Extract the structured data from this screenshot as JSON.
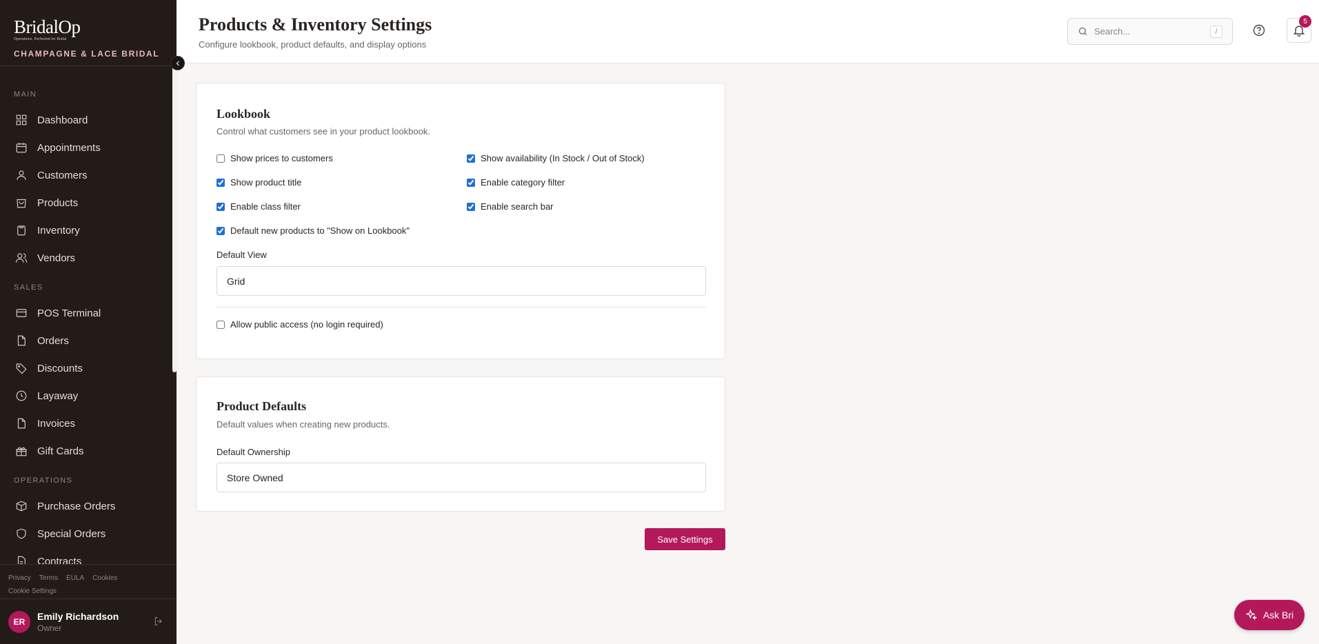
{
  "brand": {
    "logo": "BridalOp",
    "tagline": "Operations, Perfected for Bridal",
    "store_name": "CHAMPAGNE & LACE BRIDAL"
  },
  "sidebar": {
    "sections": {
      "main": "MAIN",
      "sales": "SALES",
      "operations": "OPERATIONS"
    },
    "items": {
      "dashboard": "Dashboard",
      "appointments": "Appointments",
      "customers": "Customers",
      "products": "Products",
      "inventory": "Inventory",
      "vendors": "Vendors",
      "pos": "POS Terminal",
      "orders": "Orders",
      "discounts": "Discounts",
      "layaway": "Layaway",
      "invoices": "Invoices",
      "gift_cards": "Gift Cards",
      "purchase_orders": "Purchase Orders",
      "special_orders": "Special Orders",
      "contracts": "Contracts"
    },
    "footer_links": {
      "privacy": "Privacy",
      "terms": "Terms",
      "eula": "EULA",
      "cookies": "Cookies",
      "cookie_settings": "Cookie Settings"
    },
    "user": {
      "initials": "ER",
      "name": "Emily Richardson",
      "role": "Owner"
    }
  },
  "header": {
    "title": "Products & Inventory Settings",
    "subtitle": "Configure lookbook, product defaults, and display options",
    "search_placeholder": "Search...",
    "search_shortcut": "/",
    "notification_count": "5"
  },
  "lookbook": {
    "title": "Lookbook",
    "description": "Control what customers see in your product lookbook.",
    "options": {
      "show_prices": {
        "label": "Show prices to customers",
        "checked": false
      },
      "show_availability": {
        "label": "Show availability (In Stock / Out of Stock)",
        "checked": true
      },
      "show_title": {
        "label": "Show product title",
        "checked": true
      },
      "category_filter": {
        "label": "Enable category filter",
        "checked": true
      },
      "class_filter": {
        "label": "Enable class filter",
        "checked": true
      },
      "search_bar": {
        "label": "Enable search bar",
        "checked": true
      },
      "default_show": {
        "label": "Default new products to \"Show on Lookbook\"",
        "checked": true
      },
      "public_access": {
        "label": "Allow public access (no login required)",
        "checked": false
      }
    },
    "default_view_label": "Default View",
    "default_view_value": "Grid"
  },
  "product_defaults": {
    "title": "Product Defaults",
    "description": "Default values when creating new products.",
    "ownership_label": "Default Ownership",
    "ownership_value": "Store Owned"
  },
  "actions": {
    "save": "Save Settings",
    "ask": "Ask Bri"
  },
  "colors": {
    "accent": "#b3195a",
    "sidebar_bg": "#221b18",
    "checkbox": "#1f6fd6"
  }
}
